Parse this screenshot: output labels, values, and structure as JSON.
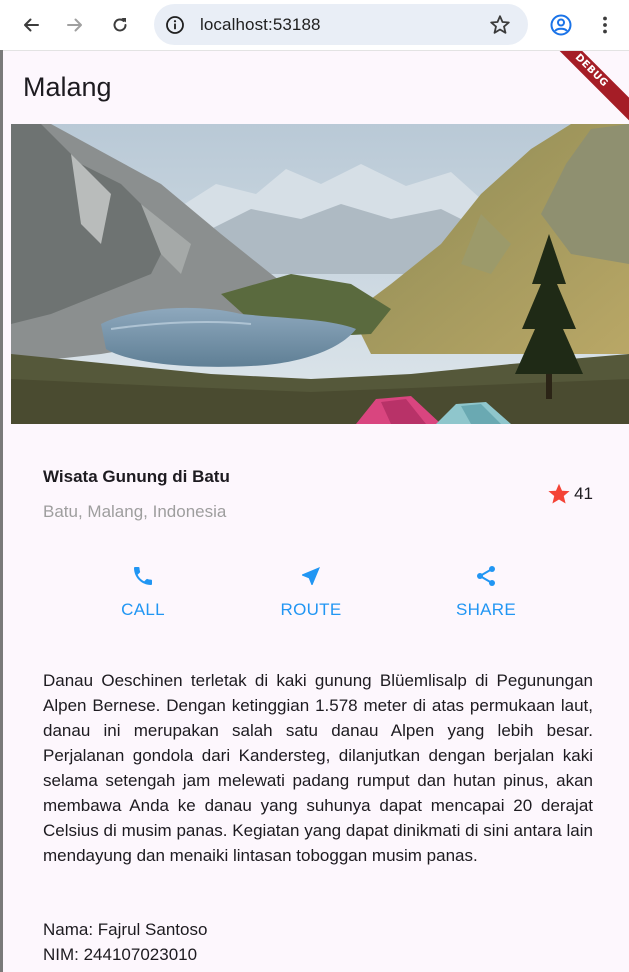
{
  "browser": {
    "url": "localhost:53188"
  },
  "app": {
    "title": "Malang",
    "debug_label": "DEBUG",
    "place": {
      "name": "Wisata Gunung di Batu",
      "location": "Batu, Malang, Indonesia",
      "rating_count": "41",
      "star_color": "#f44336"
    },
    "actions": [
      {
        "label": "CALL",
        "icon": "phone-icon"
      },
      {
        "label": "ROUTE",
        "icon": "near-me-icon"
      },
      {
        "label": "SHARE",
        "icon": "share-icon"
      }
    ],
    "accent_color": "#2196f3",
    "description": "Danau Oeschinen terletak di kaki gunung Blüemlisalp di Pegunungan Alpen Bernese. Dengan ketinggian 1.578 meter di atas permukaan laut, danau ini merupakan salah satu danau Alpen yang lebih besar. Perjalanan gondola dari Kandersteg, dilanjutkan dengan berjalan kaki selama setengah jam melewati padang rumput dan hutan pinus, akan membawa Anda ke danau yang suhunya dapat mencapai 20 derajat Celsius di musim panas. Kegiatan yang dapat dinikmati di sini antara lain mendayung dan menaiki lintasan toboggan musim panas.",
    "author_name": "Nama: Fajrul Santoso",
    "author_nim": "NIM: 244107023010"
  }
}
